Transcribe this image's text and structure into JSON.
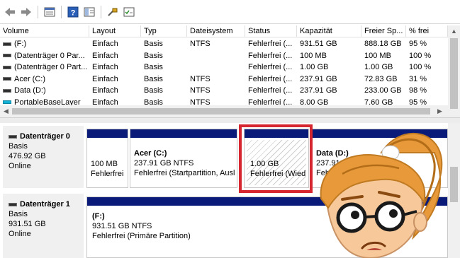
{
  "toolbar": {
    "icons": [
      "back-arrow-icon",
      "forward-arrow-icon",
      "volume-list-icon",
      "help-icon",
      "console-icon",
      "disk-map-icon",
      "properties-icon"
    ]
  },
  "columns": [
    "Volume",
    "Layout",
    "Typ",
    "Dateisystem",
    "Status",
    "Kapazität",
    "Freier Sp...",
    "% frei"
  ],
  "volumes": [
    {
      "name": "(F:)",
      "layout": "Einfach",
      "type": "Basis",
      "fs": "NTFS",
      "status": "Fehlerfrei (...",
      "capacity": "931.51 GB",
      "free": "888.18 GB",
      "pct": "95 %",
      "icon": "drive-icon"
    },
    {
      "name": "(Datenträger 0 Par...",
      "layout": "Einfach",
      "type": "Basis",
      "fs": "",
      "status": "Fehlerfrei (...",
      "capacity": "100 MB",
      "free": "100 MB",
      "pct": "100 %",
      "icon": "drive-icon"
    },
    {
      "name": "(Datenträger 0 Part...",
      "layout": "Einfach",
      "type": "Basis",
      "fs": "",
      "status": "Fehlerfrei (...",
      "capacity": "1.00 GB",
      "free": "1.00 GB",
      "pct": "100 %",
      "icon": "drive-icon"
    },
    {
      "name": "Acer (C:)",
      "layout": "Einfach",
      "type": "Basis",
      "fs": "NTFS",
      "status": "Fehlerfrei (...",
      "capacity": "237.91 GB",
      "free": "72.83 GB",
      "pct": "31 %",
      "icon": "drive-icon"
    },
    {
      "name": "Data (D:)",
      "layout": "Einfach",
      "type": "Basis",
      "fs": "NTFS",
      "status": "Fehlerfrei (...",
      "capacity": "237.91 GB",
      "free": "233.00 GB",
      "pct": "98 %",
      "icon": "drive-icon"
    },
    {
      "name": "PortableBaseLayer",
      "layout": "Einfach",
      "type": "Basis",
      "fs": "NTFS",
      "status": "Fehlerfrei (...",
      "capacity": "8.00 GB",
      "free": "7.60 GB",
      "pct": "95 %",
      "icon": "drive-cyan-icon"
    }
  ],
  "disks": [
    {
      "name": "Datenträger 0",
      "type": "Basis",
      "size": "476.92 GB",
      "state": "Online",
      "partitions": [
        {
          "title": "",
          "line1": "100 MB",
          "line2": "Fehlerfrei",
          "hatched": false
        },
        {
          "title": "Acer (C:)",
          "line1": "237.91 GB NTFS",
          "line2": "Fehlerfrei (Startpartition, Ausl",
          "hatched": false
        },
        {
          "title": "",
          "line1": "1.00 GB",
          "line2": "Fehlerfrei (Wied",
          "hatched": true
        },
        {
          "title": "Data (D:)",
          "line1": "237.91 GB NTFS",
          "line2": "Fehlerfrei (Prim",
          "hatched": false
        }
      ]
    },
    {
      "name": "Datenträger 1",
      "type": "Basis",
      "size": "931.51 GB",
      "state": "Online",
      "partitions": [
        {
          "title": "(F:)",
          "line1": "931.51 GB NTFS",
          "line2": "Fehlerfrei (Primäre Partition)",
          "hatched": false
        }
      ]
    }
  ],
  "colors": {
    "partition_bar": "#0a1a78",
    "highlight": "#d6262f",
    "avatar_hair": "#e89a3a"
  }
}
